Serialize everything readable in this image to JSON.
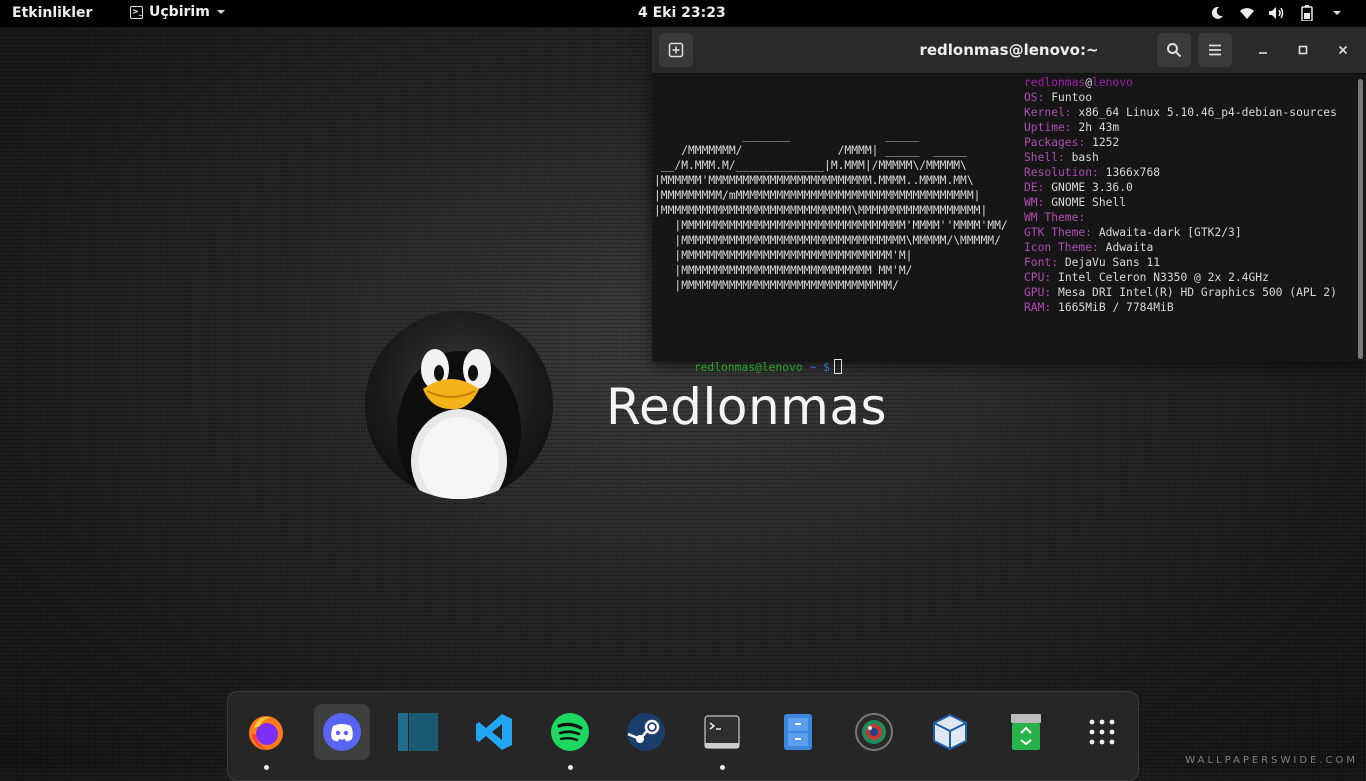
{
  "topbar": {
    "activities": "Etkinlikler",
    "app_menu": "Uçbirim",
    "clock": "4 Eki  23:23",
    "tray_icons": [
      "night-mode-icon",
      "wifi-icon",
      "volume-icon",
      "battery-icon"
    ]
  },
  "terminal": {
    "title": "redlonmas@lenovo:~",
    "ascii_art": "             _______              _____\n    /MMMMMMM/              /MMMM| _____  _____\n __/M.MMM.M/_____________|M.MMM|/MMMMM\\/MMMMM\\\n|MMMMMM'MMMMMMMMMMMMMMMMMMMMMMMM.MMMM..MMMM.MM\\\n|MMMMMMMMM/mMMMMMMMMMMMMMMMMMMMMMMMMMMMMMMMMMMM|\n|MMMMMMMMMMMMMMMMMMMMMMMMMMMM\\MMMMMMMMMMMMMMMMMM|\n   |MMMMMMMMMMMMMMMMMMMMMMMMMMMMMMMMM'MMMM''MMMM'MM/\n   |MMMMMMMMMMMMMMMMMMMMMMMMMMMMMMMMM\\MMMMM/\\MMMMM/\n   |MMMMMMMMMMMMMMMMMMMMMMMMMMMMMMM'M|\n   |MMMMMMMMMMMMMMMMMMMMMMMMMMMM MM'M/\n   |MMMMMMMMMMMMMMMMMMMMMMMMMMMMMMM/",
    "info_header_user": "redlonmas",
    "info_header_at": "@",
    "info_header_host": "lenovo",
    "info": [
      {
        "key": "OS:",
        "value": "Funtoo"
      },
      {
        "key": "Kernel:",
        "value": "x86_64 Linux 5.10.46_p4-debian-sources"
      },
      {
        "key": "Uptime:",
        "value": "2h 43m"
      },
      {
        "key": "Packages:",
        "value": "1252"
      },
      {
        "key": "Shell:",
        "value": "bash"
      },
      {
        "key": "Resolution:",
        "value": "1366x768"
      },
      {
        "key": "DE:",
        "value": "GNOME 3.36.0"
      },
      {
        "key": "WM:",
        "value": "GNOME Shell"
      },
      {
        "key": "WM Theme:",
        "value": ""
      },
      {
        "key": "GTK Theme:",
        "value": "Adwaita-dark [GTK2/3]"
      },
      {
        "key": "Icon Theme:",
        "value": "Adwaita"
      },
      {
        "key": "Font:",
        "value": "DejaVu Sans 11"
      },
      {
        "key": "CPU:",
        "value": "Intel Celeron N3350 @ 2x 2.4GHz"
      },
      {
        "key": "GPU:",
        "value": "Mesa DRI Intel(R) HD Graphics 500 (APL 2)"
      },
      {
        "key": "RAM:",
        "value": "1665MiB / 7784MiB"
      }
    ],
    "prompt_user": "redlonmas@lenovo",
    "prompt_path": "~",
    "prompt_symbol": "$"
  },
  "wallpaper": {
    "title": "Redlonmas",
    "watermark": "WALLPAPERSWIDE.COM"
  },
  "dock": {
    "apps": [
      {
        "name": "Firefox",
        "icon": "firefox-icon",
        "running": true,
        "active": false
      },
      {
        "name": "Discord",
        "icon": "discord-icon",
        "running": false,
        "active": true
      },
      {
        "name": "Foliate",
        "icon": "book-reader-icon",
        "running": false,
        "active": false
      },
      {
        "name": "Visual Studio Code",
        "icon": "vscode-icon",
        "running": false,
        "active": false
      },
      {
        "name": "Spotify",
        "icon": "spotify-icon",
        "running": true,
        "active": false
      },
      {
        "name": "Steam",
        "icon": "steam-icon",
        "running": false,
        "active": false
      },
      {
        "name": "Terminal",
        "icon": "terminal-icon",
        "running": true,
        "active": false
      },
      {
        "name": "Files",
        "icon": "file-cabinet-icon",
        "running": false,
        "active": false
      },
      {
        "name": "Camera",
        "icon": "camera-lens-icon",
        "running": false,
        "active": false
      },
      {
        "name": "VirtualBox",
        "icon": "virtualbox-icon",
        "running": false,
        "active": false
      },
      {
        "name": "Trash",
        "icon": "trash-icon",
        "running": false,
        "active": false
      },
      {
        "name": "Show Applications",
        "icon": "app-grid-icon",
        "running": false,
        "active": false
      }
    ]
  },
  "colors": {
    "topbar_bg": "#000000",
    "terminal_bg": "#161616",
    "terminal_header": "#2a2a2a",
    "neofetch_key": "#b04cb5",
    "prompt_green": "#23a723",
    "dock_bg": "#262626"
  }
}
